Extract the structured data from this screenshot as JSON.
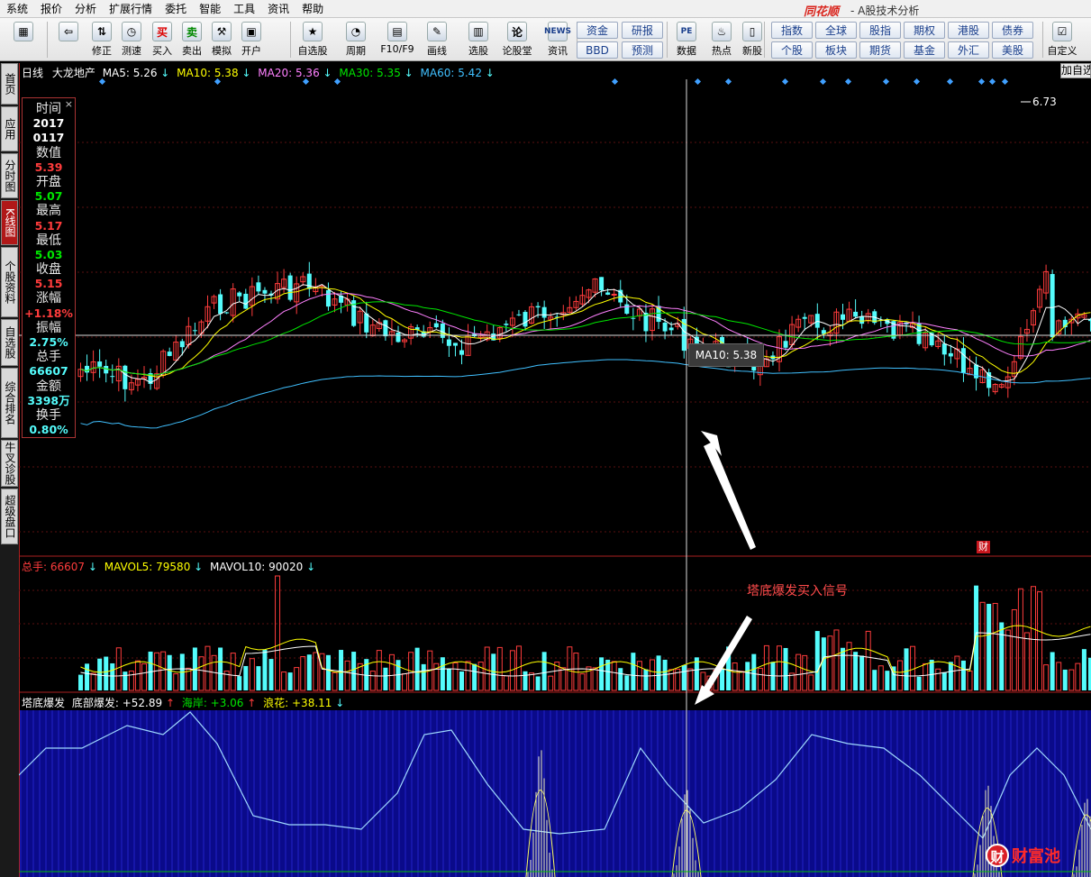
{
  "menu": [
    "系统",
    "报价",
    "分析",
    "扩展行情",
    "委托",
    "智能",
    "工具",
    "资讯",
    "帮助"
  ],
  "app": {
    "brand": "同花顺",
    "subtitle": "- A股技术分析"
  },
  "toolbar": {
    "buttons": [
      {
        "label": "",
        "icon": "grid-icon"
      },
      {
        "label": "",
        "icon": "back-arrow-icon"
      },
      {
        "label": "修正",
        "icon": "up-down-arrow-icon"
      },
      {
        "label": "测速",
        "icon": "clock-icon"
      },
      {
        "label": "买入",
        "icon": "买"
      },
      {
        "label": "卖出",
        "icon": "卖"
      },
      {
        "label": "模拟",
        "icon": "hammer-icon"
      },
      {
        "label": "开户",
        "icon": "lock-icon"
      },
      {
        "label": "自选股",
        "icon": "star-icon"
      },
      {
        "label": "周期",
        "icon": "cycle-icon"
      },
      {
        "label": "F10/F9",
        "icon": "f10-icon"
      },
      {
        "label": "画线",
        "icon": "pen-icon"
      },
      {
        "label": "选股",
        "icon": "select-stock-icon"
      },
      {
        "label": "论股堂",
        "icon": "forum-icon"
      },
      {
        "label": "资讯",
        "icon": "NEWS"
      },
      {
        "label": "数据",
        "icon": "PE"
      },
      {
        "label": "热点",
        "icon": "hot-icon"
      },
      {
        "label": "新股",
        "icon": "new-stock-icon"
      },
      {
        "label": "自定义",
        "icon": "custom-icon"
      }
    ],
    "small_buttons": [
      "资金",
      "研报",
      "BBD",
      "预测",
      "指数",
      "全球",
      "股指",
      "期权",
      "港股",
      "债券",
      "个股",
      "板块",
      "期货",
      "基金",
      "外汇",
      "美股"
    ]
  },
  "left_tabs": [
    "首页",
    "应用",
    "分时图",
    "K线图",
    "个股资料",
    "自选股",
    "综合排名",
    "牛叉诊股",
    "超级盘口"
  ],
  "header": {
    "period": "日线",
    "stock": "大龙地产",
    "ma5": "MA5: 5.26",
    "ma10": "MA10: 5.38",
    "ma20": "MA20: 5.36",
    "ma30": "MA30: 5.35",
    "ma60": "MA60: 5.42",
    "add_button": "加自选"
  },
  "info_panel": {
    "time_label": "时间",
    "year": "2017",
    "date": "0117",
    "value_label": "数值",
    "value": "5.39",
    "open_label": "开盘",
    "open": "5.07",
    "high_label": "最高",
    "high": "5.17",
    "low_label": "最低",
    "low": "5.03",
    "close_label": "收盘",
    "close": "5.15",
    "change_label": "涨幅",
    "change": "+1.18%",
    "amp_label": "振幅",
    "amp": "2.75%",
    "vol_label": "总手",
    "vol": "66607",
    "amount_label": "金额",
    "amount": "3398万",
    "turnover_label": "换手",
    "turnover": "0.80%",
    "close_mark": "×"
  },
  "tooltip": "MA10: 5.38",
  "peak_label": "6.73",
  "volume_header": {
    "vol": "总手: 66607",
    "mavol5": "MAVOL5: 79580",
    "mavol10": "MAVOL10: 90020"
  },
  "indicator_header": {
    "name": "塔底爆发",
    "bottom": "底部爆发: +52.89",
    "coast": "海岸: +3.06",
    "wave": "浪花: +38.11"
  },
  "annotation": "塔底爆发买入信号",
  "cai_badge": "财",
  "watermark": {
    "logo": "财",
    "text": "财富池"
  },
  "colors": {
    "up": "#ff3c3c",
    "down": "#54fcfc",
    "ma5": "#ffffff",
    "ma10": "#ffff00",
    "ma20": "#ff80ff",
    "ma30": "#00e600",
    "ma60": "#40c0ff",
    "indicator_bg": "#0a0a8a"
  }
}
